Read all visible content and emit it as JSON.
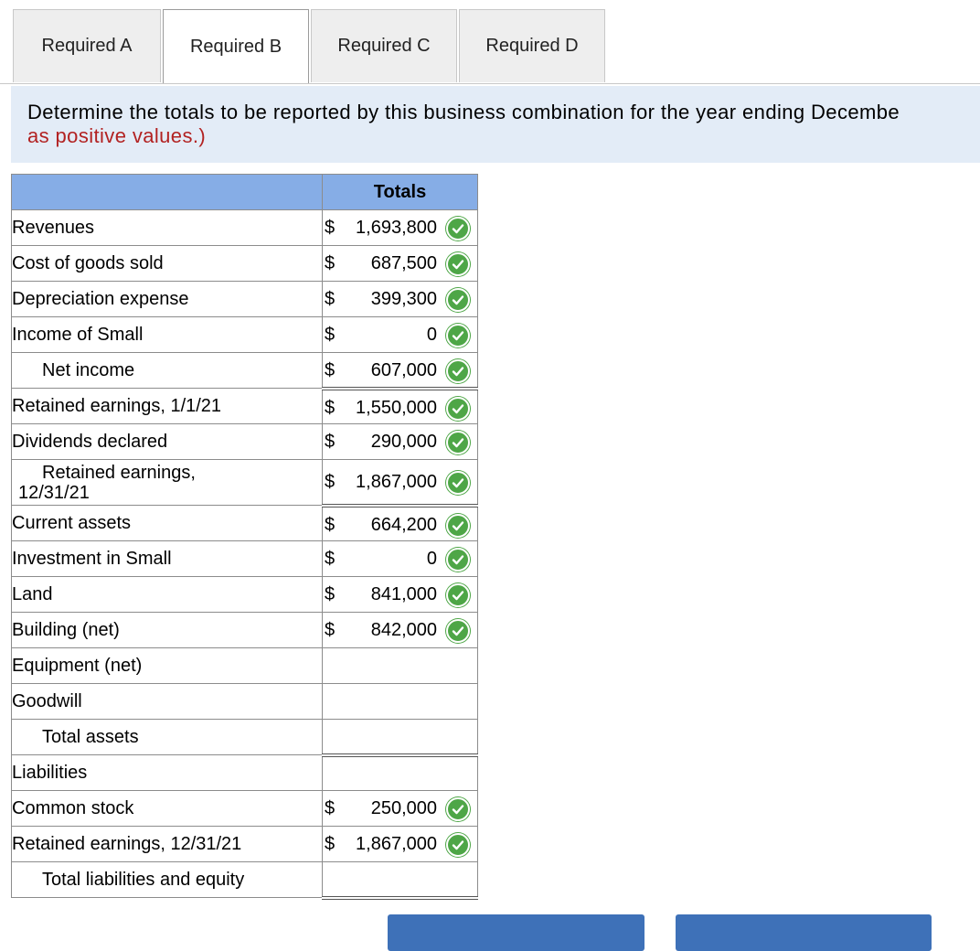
{
  "tabs": [
    "Required A",
    "Required B",
    "Required C",
    "Required D"
  ],
  "instructions": {
    "line1": "Determine the totals to be reported by this business combination for the year ending Decembe",
    "line2": "as positive values.)"
  },
  "table": {
    "header": "Totals",
    "rows": [
      {
        "label": "Revenues",
        "dollar": "$",
        "value": "1,693,800",
        "check": true
      },
      {
        "label": "Cost of goods sold",
        "dollar": "$",
        "value": "687,500",
        "check": true
      },
      {
        "label": "Depreciation expense",
        "dollar": "$",
        "value": "399,300",
        "check": true
      },
      {
        "label": "Income of Small",
        "dollar": "$",
        "value": "0",
        "check": true
      },
      {
        "label": "Net income",
        "dollar": "$",
        "value": "607,000",
        "check": true
      },
      {
        "label": "Retained earnings, 1/1/21",
        "dollar": "$",
        "value": "1,550,000",
        "check": true
      },
      {
        "label": "Dividends declared",
        "dollar": "$",
        "value": "290,000",
        "check": true
      },
      {
        "label_a": "Retained earnings,",
        "label_b": "12/31/21",
        "dollar": "$",
        "value": "1,867,000",
        "check": true
      },
      {
        "label": "Current assets",
        "dollar": "$",
        "value": "664,200",
        "check": true
      },
      {
        "label": "Investment in Small",
        "dollar": "$",
        "value": "0",
        "check": true
      },
      {
        "label": "Land",
        "dollar": "$",
        "value": "841,000",
        "check": true
      },
      {
        "label": "Building (net)",
        "dollar": "$",
        "value": "842,000",
        "check": true
      },
      {
        "label": "Equipment (net)",
        "dollar": "",
        "value": "",
        "check": false
      },
      {
        "label": "Goodwill",
        "dollar": "",
        "value": "",
        "check": false
      },
      {
        "label": "Total assets",
        "dollar": "",
        "value": "",
        "check": false
      },
      {
        "label": "Liabilities",
        "dollar": "",
        "value": "",
        "check": false
      },
      {
        "label": "Common stock",
        "dollar": "$",
        "value": "250,000",
        "check": true
      },
      {
        "label": "Retained earnings, 12/31/21",
        "dollar": "$",
        "value": "1,867,000",
        "check": true
      },
      {
        "label": "Total liabilities and equity",
        "dollar": "",
        "value": "",
        "check": false
      }
    ]
  },
  "colors": {
    "header_bg": "#86ade6",
    "instr_bg": "#e3ecf7",
    "check_green": "#4ea647",
    "red_text": "#b22222",
    "button_blue": "#3e71b8"
  }
}
